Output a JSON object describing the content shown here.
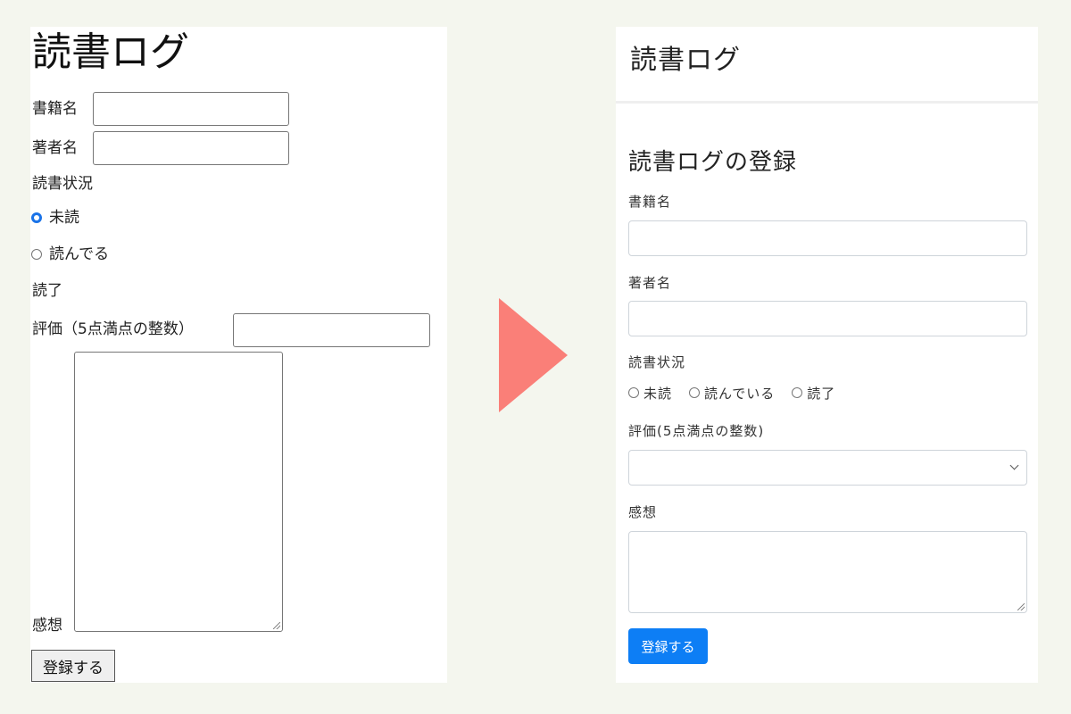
{
  "before": {
    "title": "読書ログ",
    "book_title_label": "書籍名",
    "author_label": "著者名",
    "status_label": "読書状況",
    "status_options": [
      "未読",
      "読んでる",
      "読了"
    ],
    "status_selected": "未読",
    "rating_label": "評価（5点満点の整数）",
    "comment_label": "感想",
    "submit_label": "登録する"
  },
  "after": {
    "brand": "読書ログ",
    "heading": "読書ログの登録",
    "book_title_label": "書籍名",
    "author_label": "著者名",
    "status_label": "読書状況",
    "status_options": [
      "未読",
      "読んでいる",
      "読了"
    ],
    "rating_label": "評価(5点満点の整数)",
    "comment_label": "感想",
    "submit_label": "登録する"
  },
  "colors": {
    "background": "#f4f6ee",
    "arrow": "#fa7f78",
    "primary_button": "#0d7ef5",
    "radio_checked": "#1a73e8"
  }
}
